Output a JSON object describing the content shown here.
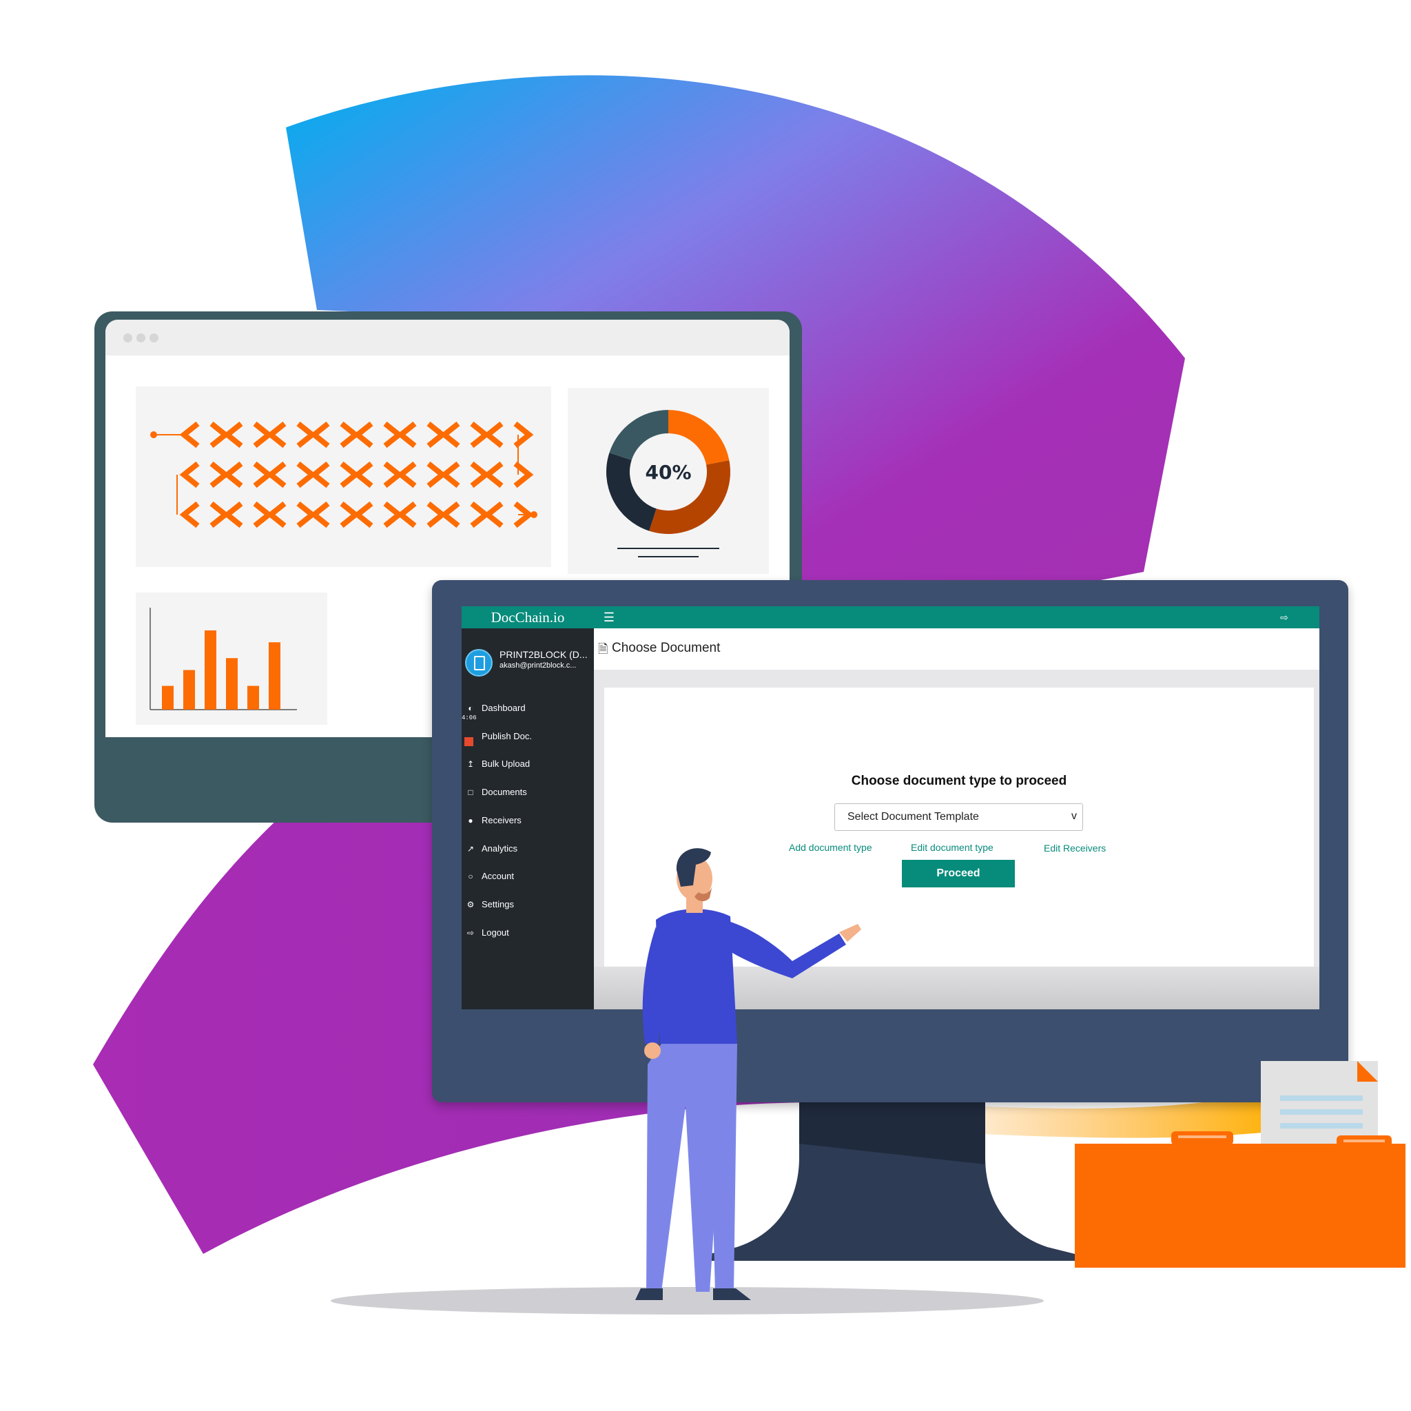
{
  "back_window": {
    "donut_label": "40%",
    "donut_value_percent": 40,
    "bar_chart_values": [
      3,
      5,
      10,
      6.5,
      3,
      8.5
    ]
  },
  "app": {
    "brand": "DocChain.io",
    "user": {
      "name": "PRINT2BLOCK (D...",
      "email": "akash@print2block.c..."
    },
    "clock": "4:06",
    "sidebar": {
      "items": [
        {
          "label": "Dashboard",
          "icon": "tachometer-icon"
        },
        {
          "label": "Publish Doc.",
          "icon": "publish-icon"
        },
        {
          "label": "Bulk Upload",
          "icon": "upload-icon"
        },
        {
          "label": "Documents",
          "icon": "file-icon"
        },
        {
          "label": "Receivers",
          "icon": "users-icon"
        },
        {
          "label": "Analytics",
          "icon": "line-chart-icon"
        },
        {
          "label": "Account",
          "icon": "user-icon"
        },
        {
          "label": "Settings",
          "icon": "gear-icon"
        },
        {
          "label": "Logout",
          "icon": "sign-out-icon"
        }
      ]
    },
    "header": {
      "title": "Choose Document"
    },
    "main": {
      "heading": "Choose document type to proceed",
      "select_value": "Select Document Template",
      "select_caret": "v",
      "links": {
        "add": "Add document type",
        "edit": "Edit document type",
        "receivers": "Edit Receivers"
      },
      "proceed": "Proceed"
    }
  },
  "colors": {
    "brand_teal": "#078b7b",
    "sidebar_dark": "#23282d",
    "accent_orange": "#fd6c02",
    "monitor_frame": "#3c4f6e",
    "back_window_frame": "#3c5a62"
  }
}
